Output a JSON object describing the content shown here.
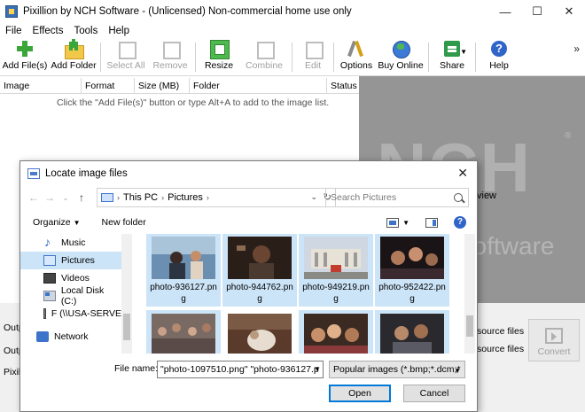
{
  "app": {
    "title": "Pixillion by NCH Software - (Unlicensed) Non-commercial home use only",
    "window_controls": {
      "minimize": "—",
      "maximize": "☐",
      "close": "✕"
    }
  },
  "menu": [
    "File",
    "Effects",
    "Tools",
    "Help"
  ],
  "toolbar": {
    "add_files": "Add File(s)",
    "add_folder": "Add Folder",
    "select_all": "Select All",
    "remove": "Remove",
    "resize": "Resize",
    "combine": "Combine",
    "edit": "Edit",
    "options": "Options",
    "buy_online": "Buy Online",
    "share": "Share",
    "help": "Help",
    "more": "»"
  },
  "table": {
    "columns": [
      "Image",
      "Format",
      "Size (MB)",
      "Folder",
      "Status"
    ],
    "empty_hint": "Click the \"Add File(s)\" button or type Alt+A to add to the image list."
  },
  "right_panel": {
    "logo": "NCH",
    "registered": "®",
    "software": "Software",
    "preview_fragment": "view"
  },
  "bottom": {
    "output_labels": [
      "Outp",
      "Outp"
    ],
    "source_files": [
      "source files",
      "source files"
    ],
    "convert": "Convert",
    "status_fragment": "Pixill"
  },
  "dialog": {
    "title": "Locate image files",
    "close": "✕",
    "nav": {
      "back": "←",
      "forward": "→",
      "down": "⌄",
      "up": "↑"
    },
    "path": [
      "This PC",
      "Pictures"
    ],
    "refresh": "↻",
    "search_placeholder": "Search Pictures",
    "organize": "Organize",
    "new_folder": "New folder",
    "help": "?",
    "nav_items": [
      {
        "label": "Music",
        "icon": "music-icon"
      },
      {
        "label": "Pictures",
        "icon": "pictures-icon",
        "selected": true
      },
      {
        "label": "Videos",
        "icon": "videos-icon"
      },
      {
        "label": "Local Disk (C:)",
        "icon": "disk-icon"
      },
      {
        "label": "F (\\\\USA-SERVE",
        "icon": "network-drive-icon"
      },
      {
        "label": "Network",
        "icon": "network-icon"
      }
    ],
    "files": [
      {
        "name1": "photo-936127.pn",
        "name2": "g",
        "selected": true
      },
      {
        "name1": "photo-944762.pn",
        "name2": "g",
        "selected": true
      },
      {
        "name1": "photo-949219.pn",
        "name2": "g",
        "selected": true
      },
      {
        "name1": "photo-952422.pn",
        "name2": "g",
        "selected": true
      },
      {
        "name1": "",
        "name2": "",
        "selected": true
      },
      {
        "name1": "",
        "name2": "",
        "selected": false
      },
      {
        "name1": "",
        "name2": "",
        "selected": true
      },
      {
        "name1": "",
        "name2": "",
        "selected": true
      }
    ],
    "file_name_label": "File name:",
    "file_name_value": "\"photo-1097510.png\" \"photo-936127.p",
    "file_type": "Popular images (*.bmp;*.dcm;*",
    "open": "Open",
    "cancel": "Cancel"
  },
  "colors": {
    "selection": "#cce4f7",
    "dialog_accent": "#0078d7",
    "panel_gray": "#959595"
  }
}
